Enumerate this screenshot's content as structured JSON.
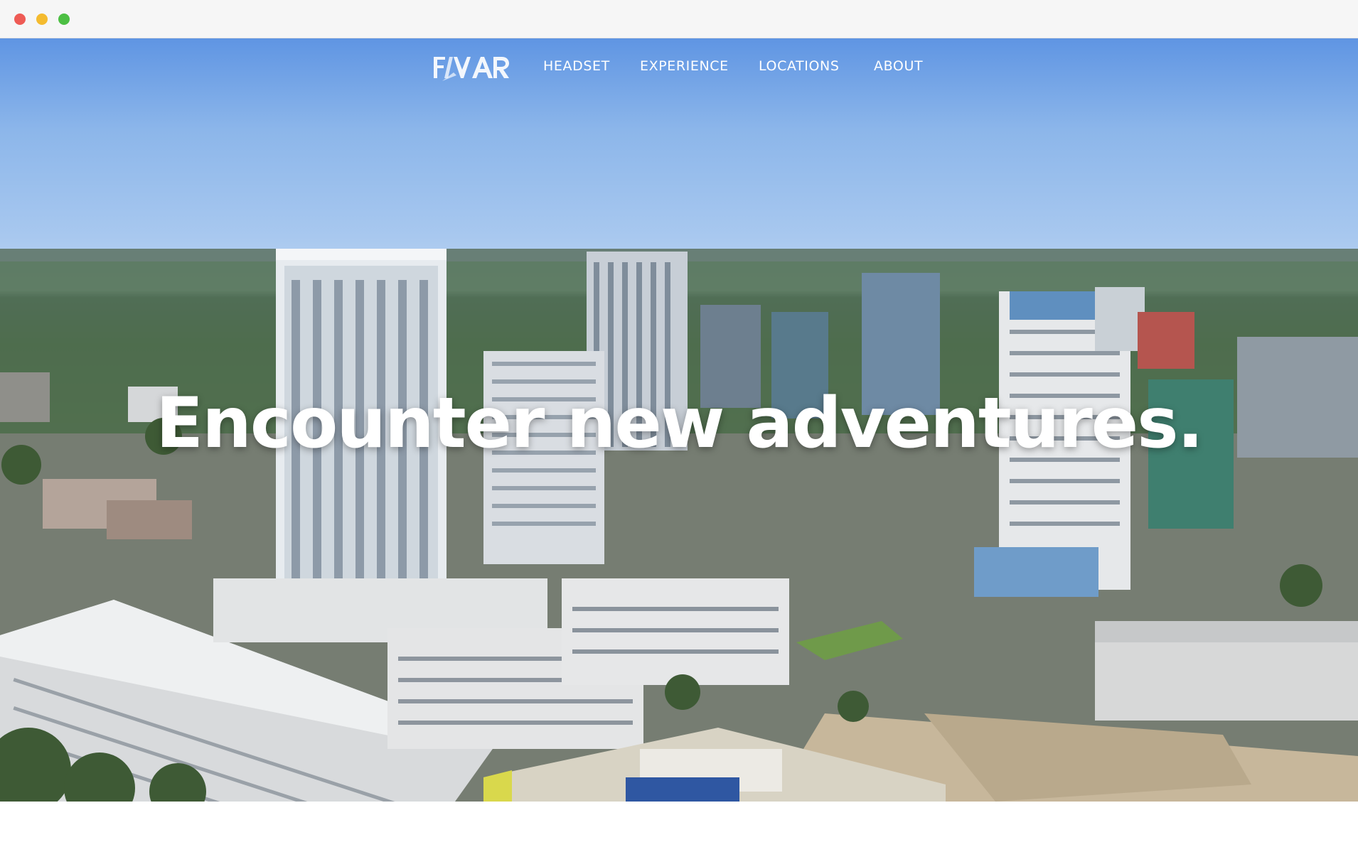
{
  "window": {
    "controls": [
      "close",
      "minimize",
      "maximize"
    ]
  },
  "brand": {
    "logo_text": "FLYVAR",
    "logo_icon": "flyvar-logo-mark"
  },
  "nav": {
    "items": [
      {
        "label": "HEADSET"
      },
      {
        "label": "EXPERIENCE"
      },
      {
        "label": "LOCATIONS"
      },
      {
        "label": "ABOUT"
      }
    ]
  },
  "hero": {
    "headline": "Encounter new adventures.",
    "background": "aerial-city-skyline-photo"
  },
  "colors": {
    "nav_text": "#ffffff",
    "headline": "#ffffff",
    "sky_top": "#5f95e3",
    "sky_horizon": "#bfd6f1"
  }
}
